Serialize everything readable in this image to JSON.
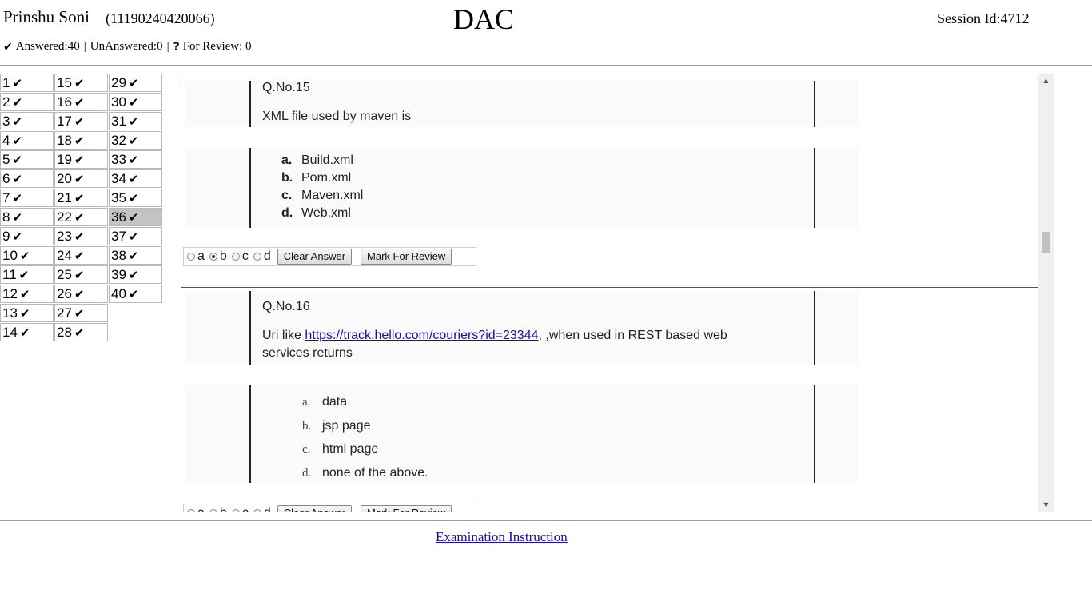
{
  "header": {
    "candidate_name": "Prinshu Soni",
    "candidate_id": "(11190240420066)",
    "exam_title": "DAC",
    "session": "Session Id:4712"
  },
  "stats": {
    "answered": "Answered:40",
    "unanswered": "UnAnswered:0",
    "review_icon": "?",
    "for_review": "For Review: 0",
    "check_icon": "✔"
  },
  "grid": {
    "columns": [
      [
        "1",
        "2",
        "3",
        "4",
        "5",
        "6",
        "7",
        "8",
        "9",
        "10",
        "11",
        "12",
        "13",
        "14"
      ],
      [
        "15",
        "16",
        "17",
        "18",
        "19",
        "20",
        "21",
        "22",
        "23",
        "24",
        "25",
        "26",
        "27",
        "28"
      ],
      [
        "29",
        "30",
        "31",
        "32",
        "33",
        "34",
        "35",
        "36",
        "37",
        "38",
        "39",
        "40"
      ]
    ],
    "active": "36",
    "check": "✔"
  },
  "questions": [
    {
      "number": "Q.No.15",
      "text": "XML file used by maven is",
      "options": [
        {
          "letter": "a.",
          "text": "Build.xml"
        },
        {
          "letter": "b.",
          "text": "Pom.xml"
        },
        {
          "letter": "c.",
          "text": "Maven.xml"
        },
        {
          "letter": "d.",
          "text": "Web.xml"
        }
      ],
      "choices": [
        "a",
        "b",
        "c",
        "d"
      ],
      "selected": "b",
      "clear_label": "Clear Answer",
      "review_label": "Mark For Review"
    },
    {
      "number": "Q.No.16",
      "text_before": "Uri like ",
      "link": "https://track.hello.com/couriers?id=23344",
      "text_after": ", ,when used in REST based web services returns",
      "options": [
        {
          "letter": "a.",
          "text": "data"
        },
        {
          "letter": "b.",
          "text": "jsp page"
        },
        {
          "letter": "c.",
          "text": "html page"
        },
        {
          "letter": "d.",
          "text": "none of the above."
        }
      ],
      "choices": [
        "a",
        "b",
        "c",
        "d"
      ],
      "selected": "a",
      "clear_label": "Clear Answer",
      "review_label": "Mark For Review"
    }
  ],
  "footer": {
    "instruction_link": "Examination Instruction"
  }
}
